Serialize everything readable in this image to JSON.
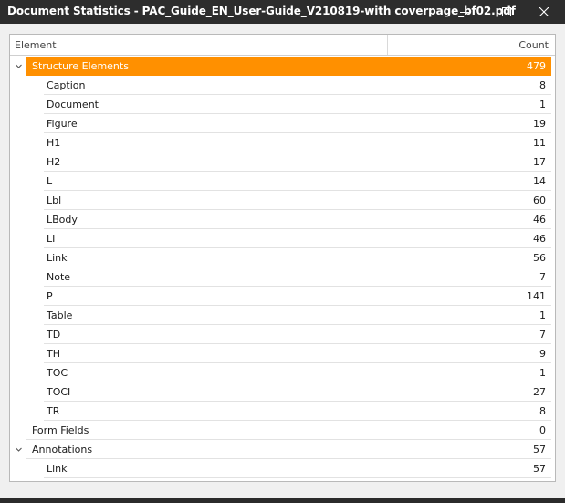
{
  "window": {
    "title": "Document Statistics - PAC_Guide_EN_User-Guide_V210819-with coverpage_bf02.pdf",
    "minimize_icon": "minimize-icon",
    "maximize_icon": "maximize-icon",
    "close_icon": "close-icon"
  },
  "table": {
    "columns": [
      "Element",
      "Count"
    ],
    "rows": [
      {
        "label": "Structure Elements",
        "count": "479",
        "level": 0,
        "expanded": true,
        "selected": true
      },
      {
        "label": "Caption",
        "count": "8",
        "level": 1
      },
      {
        "label": "Document",
        "count": "1",
        "level": 1
      },
      {
        "label": "Figure",
        "count": "19",
        "level": 1
      },
      {
        "label": "H1",
        "count": "11",
        "level": 1
      },
      {
        "label": "H2",
        "count": "17",
        "level": 1
      },
      {
        "label": "L",
        "count": "14",
        "level": 1
      },
      {
        "label": "Lbl",
        "count": "60",
        "level": 1
      },
      {
        "label": "LBody",
        "count": "46",
        "level": 1
      },
      {
        "label": "LI",
        "count": "46",
        "level": 1
      },
      {
        "label": "Link",
        "count": "56",
        "level": 1
      },
      {
        "label": "Note",
        "count": "7",
        "level": 1
      },
      {
        "label": "P",
        "count": "141",
        "level": 1
      },
      {
        "label": "Table",
        "count": "1",
        "level": 1
      },
      {
        "label": "TD",
        "count": "7",
        "level": 1
      },
      {
        "label": "TH",
        "count": "9",
        "level": 1
      },
      {
        "label": "TOC",
        "count": "1",
        "level": 1
      },
      {
        "label": "TOCI",
        "count": "27",
        "level": 1
      },
      {
        "label": "TR",
        "count": "8",
        "level": 1
      },
      {
        "label": "Form Fields",
        "count": "0",
        "level": 0,
        "expanded": null
      },
      {
        "label": "Annotations",
        "count": "57",
        "level": 0,
        "expanded": true
      },
      {
        "label": "Link",
        "count": "57",
        "level": 1
      }
    ]
  },
  "colors": {
    "selection": "#ff9000",
    "titlebar": "#2d2d2d"
  }
}
